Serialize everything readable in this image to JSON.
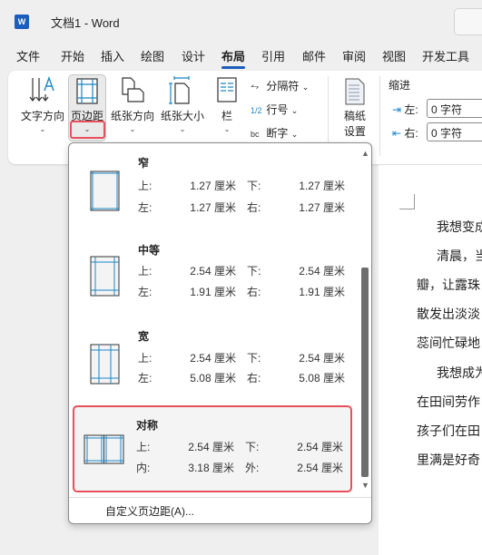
{
  "window": {
    "title": "文档1  -  Word",
    "app_icon": "word-icon",
    "app_letter": "W"
  },
  "tabs": [
    {
      "label": "文件"
    },
    {
      "label": "开始"
    },
    {
      "label": "插入"
    },
    {
      "label": "绘图"
    },
    {
      "label": "设计"
    },
    {
      "label": "布局",
      "active": true
    },
    {
      "label": "引用"
    },
    {
      "label": "邮件"
    },
    {
      "label": "审阅"
    },
    {
      "label": "视图"
    },
    {
      "label": "开发工具"
    }
  ],
  "ribbon": {
    "text_direction": "文字方向",
    "margins": "页边距",
    "orientation": "纸张方向",
    "size": "纸张大小",
    "columns": "栏",
    "breaks": "分隔符",
    "line_numbers": "行号",
    "hyphenation": "断字",
    "manuscript_1": "稿纸",
    "manuscript_2": "设置",
    "indent": {
      "label": "缩进",
      "left_label": "左:",
      "left_value": "0 字符",
      "right_label": "右:",
      "right_value": "0 字符"
    }
  },
  "margins_menu": {
    "items": [
      {
        "name": "窄",
        "k1": "上:",
        "v1": "1.27 厘米",
        "k2": "下:",
        "v2": "1.27 厘米",
        "k3": "左:",
        "v3": "1.27 厘米",
        "k4": "右:",
        "v4": "1.27 厘米"
      },
      {
        "name": "中等",
        "k1": "上:",
        "v1": "2.54 厘米",
        "k2": "下:",
        "v2": "2.54 厘米",
        "k3": "左:",
        "v3": "1.91 厘米",
        "k4": "右:",
        "v4": "1.91 厘米"
      },
      {
        "name": "宽",
        "k1": "上:",
        "v1": "2.54 厘米",
        "k2": "下:",
        "v2": "2.54 厘米",
        "k3": "左:",
        "v3": "5.08 厘米",
        "k4": "右:",
        "v4": "5.08 厘米"
      },
      {
        "name": "对称",
        "k1": "上:",
        "v1": "2.54 厘米",
        "k2": "下:",
        "v2": "2.54 厘米",
        "k3": "内:",
        "v3": "3.18 厘米",
        "k4": "外:",
        "v4": "2.54 厘米",
        "highlighted": true
      }
    ],
    "custom": "自定义页边距(A)..."
  },
  "document": {
    "lines": [
      "我想变成",
      "清晨，当",
      "瓣，让露珠",
      "散发出淡淡",
      "蕊间忙碌地",
      "我想成为",
      "在田间劳作",
      "孩子们在田",
      "里满是好奇"
    ]
  },
  "colors": {
    "accent": "#1b5ebe",
    "highlight_border": "#e8505b",
    "thumb_line": "#1a86c8"
  }
}
